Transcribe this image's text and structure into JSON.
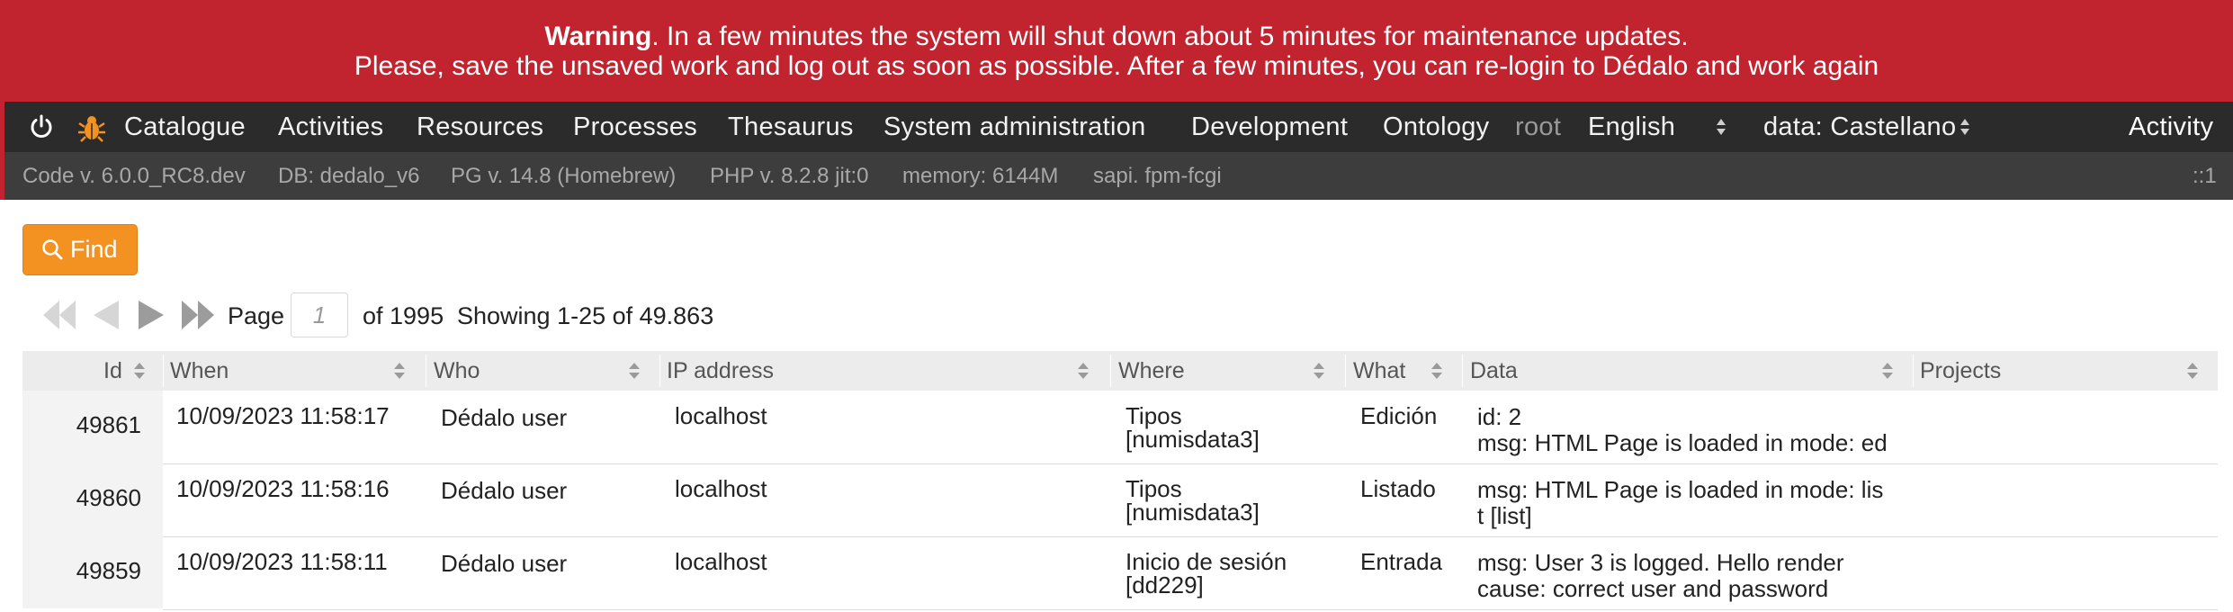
{
  "warning": {
    "bold": "Warning",
    "line1_rest": ". In a few minutes the system will shut down about 5 minutes for maintenance updates.",
    "line2": "Please, save the unsaved work and log out as soon as possible. After a few minutes, you can re-login to Dédalo and work again"
  },
  "menu": {
    "items": [
      "Catalogue",
      "Activities",
      "Resources",
      "Processes",
      "Thesaurus",
      "System administration",
      "Development",
      "Ontology"
    ],
    "user": "root",
    "language": "English",
    "data_language": "data: Castellano",
    "section_label": "Activity"
  },
  "info": {
    "code": "Code v. 6.0.0_RC8.dev",
    "db": "DB: dedalo_v6",
    "pg": "PG v. 14.8 (Homebrew)",
    "php": "PHP v. 8.2.8 jit:0",
    "memory": "memory: 6144M",
    "sapi": "sapi. fpm-fcgi",
    "right": "::1"
  },
  "find_label": "Find",
  "paginator": {
    "page_label": "Page",
    "page_value": "1",
    "of_label": "of 1995",
    "showing": "Showing 1-25 of 49.863"
  },
  "table": {
    "headers": [
      "Id",
      "When",
      "Who",
      "IP address",
      "Where",
      "What",
      "Data",
      "Projects"
    ],
    "rows": [
      {
        "id": "49861",
        "when": "10/09/2023 11:58:17",
        "who": "Dédalo user",
        "ip": "localhost",
        "where1": "Tipos",
        "where2": "[numisdata3]",
        "what": "Edición",
        "data1": "id: 2",
        "data2": "msg: HTML Page is loaded in mode: ed"
      },
      {
        "id": "49860",
        "when": "10/09/2023 11:58:16",
        "who": "Dédalo user",
        "ip": "localhost",
        "where1": "Tipos",
        "where2": "[numisdata3]",
        "what": "Listado",
        "data1": "msg: HTML Page is loaded in mode: lis",
        "data2": "t [list]"
      },
      {
        "id": "49859",
        "when": "10/09/2023 11:58:11",
        "who": "Dédalo user",
        "ip": "localhost",
        "where1": "Inicio de sesión",
        "where2": "[dd229]",
        "what": "Entrada",
        "data1": "msg: User 3 is logged. Hello render",
        "data2": "cause: correct user and password"
      }
    ]
  },
  "colors": {
    "warning_bg": "#c1232f",
    "menu_bg": "#2b2b2b",
    "info_bg": "#3d3d3d",
    "find_bg": "#f39221",
    "header_bg": "#ececec"
  }
}
